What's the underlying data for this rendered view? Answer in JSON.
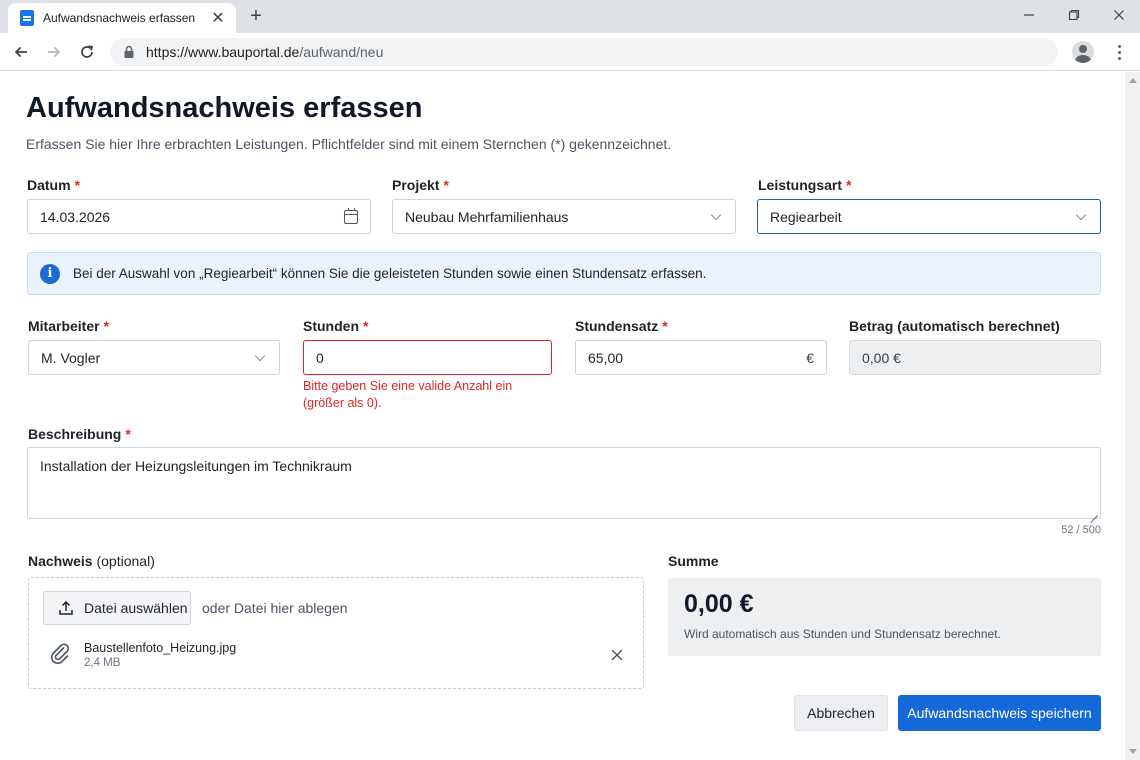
{
  "browser": {
    "tab_title": "Aufwandsnachweis erfassen",
    "url_host": "https://www.bauportal.de",
    "url_path": "/aufwand/neu"
  },
  "page": {
    "title": "Aufwandsnachweis erfassen",
    "subtitle": "Erfassen Sie hier Ihre erbrachten Leistungen. Pflichtfelder sind mit einem Sternchen (*) gekennzeichnet."
  },
  "form": {
    "datum": {
      "label": "Datum",
      "required_mark": "*",
      "value": "14.03.2026"
    },
    "projekt": {
      "label": "Projekt",
      "required_mark": "*",
      "value": "Neubau Mehrfamilienhaus"
    },
    "leistungsart": {
      "label": "Leistungsart",
      "required_mark": "*",
      "value": "Regiearbeit"
    },
    "info": "Bei der Auswahl von „Regiearbeit“ können Sie die geleisteten Stunden sowie einen Stundensatz erfassen.",
    "mitarbeiter": {
      "label": "Mitarbeiter",
      "required_mark": "*",
      "value": "M. Vogler"
    },
    "stunden": {
      "label": "Stunden",
      "required_mark": "*",
      "value": "0",
      "error_line1": "Bitte geben Sie eine valide Anzahl ein",
      "error_line2": "(größer als 0)."
    },
    "stundensatz": {
      "label": "Stundensatz",
      "required_mark": "*",
      "value": "65,00",
      "suffix": "€"
    },
    "betrag": {
      "label": "Betrag (automatisch berechnet)",
      "value": "0,00 €"
    },
    "beschreibung": {
      "label": "Beschreibung",
      "required_mark": "*",
      "value": "Installation der Heizungsleitungen im Technikraum",
      "counter": "52 / 500"
    },
    "nachweis": {
      "label": "Nachweis",
      "optional": "(optional)",
      "button_label": "Datei auswählen",
      "drop_hint": "oder Datei hier ablegen",
      "file_name": "Baustellenfoto_Heizung.jpg",
      "file_size": "2,4 MB"
    },
    "summe": {
      "label": "Summe",
      "value": "0,00 €",
      "note": "Wird automatisch aus Stunden und Stundensatz berechnet."
    }
  },
  "actions": {
    "cancel_label": "Abbrechen",
    "save_label": "Aufwandsnachweis speichern"
  },
  "colors": {
    "primary": "#1468d8",
    "error": "#dc2626",
    "info_bg": "#eaf3fc"
  }
}
